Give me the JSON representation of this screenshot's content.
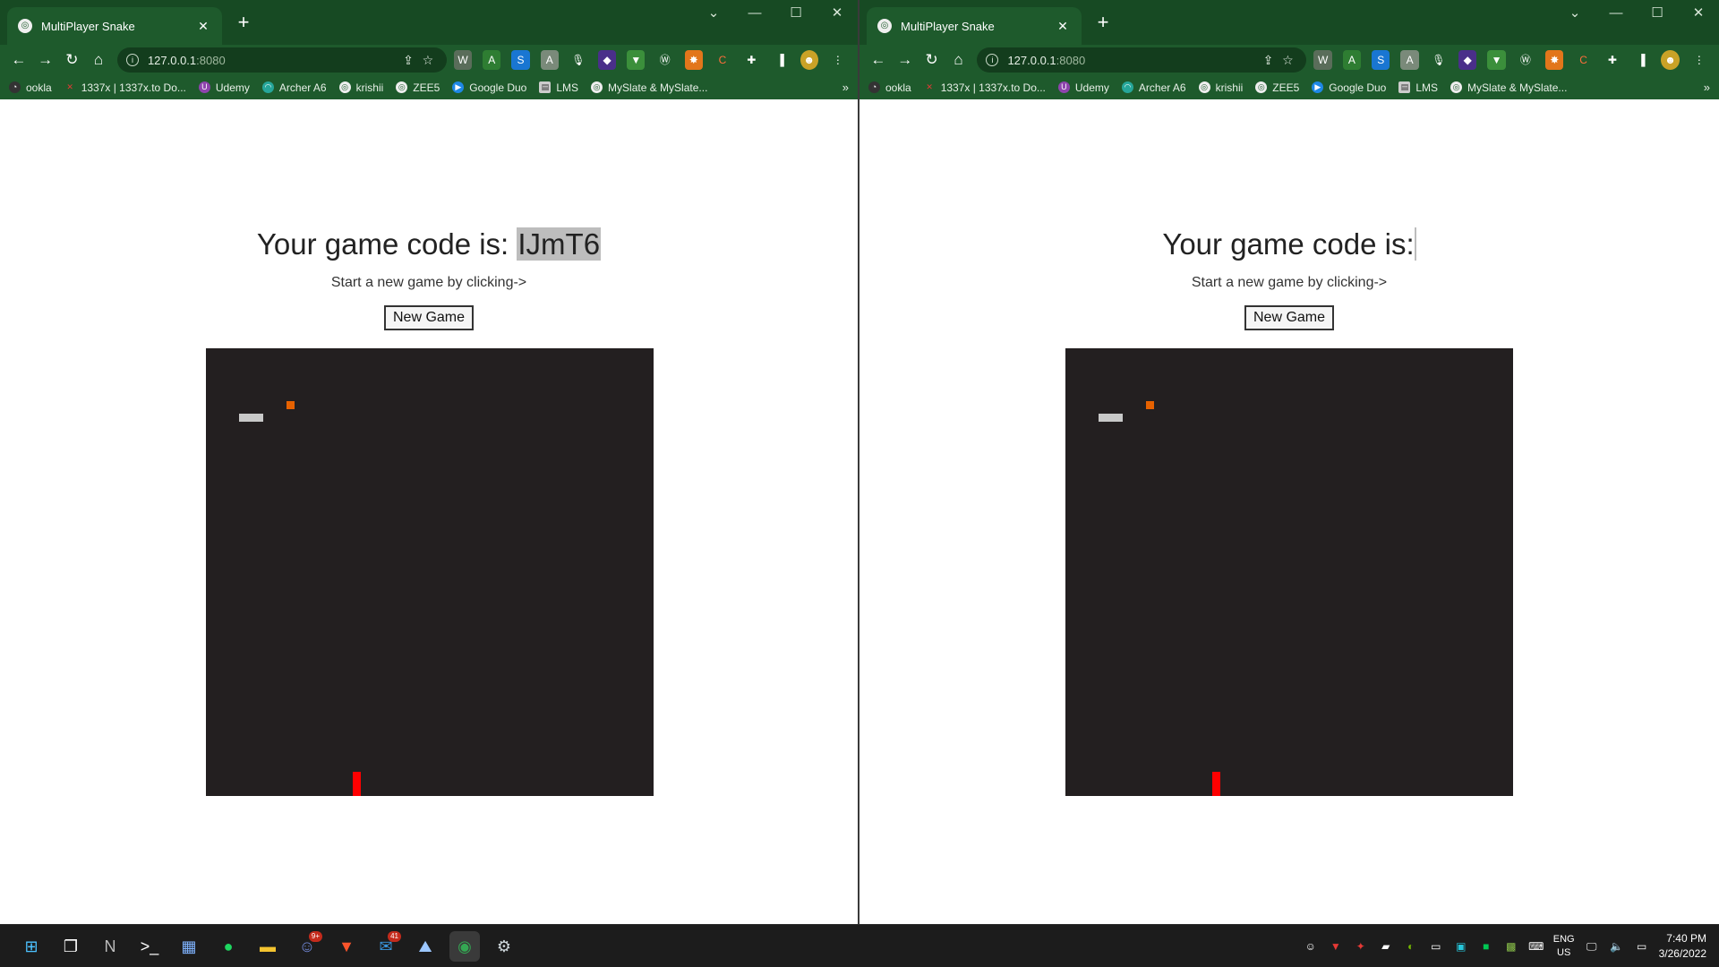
{
  "browser": {
    "tab_title": "MultiPlayer Snake",
    "url_host": "127.0.0.1",
    "url_port": ":8080",
    "bookmarks": [
      "ookla",
      "1337x | 1337x.to Do...",
      "Udemy",
      "Archer A6",
      "krishii",
      "ZEE5",
      "Google Duo",
      "LMS",
      "MySlate & MySlate..."
    ],
    "bookmarks_more": "»"
  },
  "left_page": {
    "heading_prefix": "Your game code is: ",
    "game_code": "IJmT6",
    "subtext": "Start a new game by clicking->",
    "button_label": "New Game"
  },
  "right_page": {
    "heading_prefix": "Your game code is:",
    "game_code": "",
    "subtext": "Start a new game by clicking->",
    "button_label": "New Game"
  },
  "colors": {
    "chrome_theme": "#1e5a2c",
    "board_background": "#231f20",
    "player1_snake": "#c8c8c8",
    "player2_snake": "#ff0000",
    "food": "#e66100"
  },
  "taskbar": {
    "language": "ENG",
    "region": "US",
    "time": "7:40 PM",
    "date": "3/26/2022",
    "discord_badge": "9+",
    "mail_badge": "41"
  }
}
